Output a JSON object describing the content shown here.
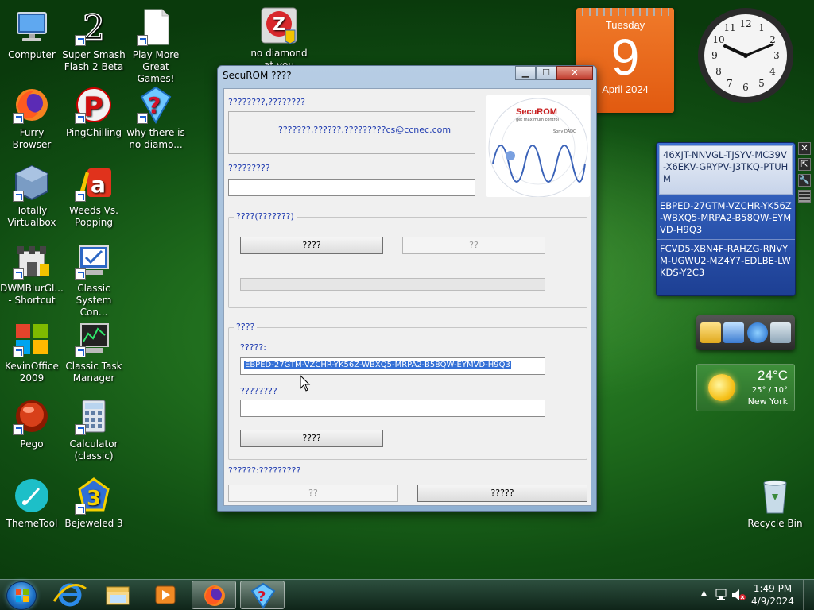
{
  "desktop": {
    "icons": [
      {
        "label": "Computer"
      },
      {
        "label": "Super Smash Flash 2 Beta"
      },
      {
        "label": "Play More Great Games!"
      },
      {
        "label": "no diamond at you"
      },
      {
        "label": "Furry Browser"
      },
      {
        "label": "PingChilling"
      },
      {
        "label": "why there is no diamo..."
      },
      {
        "label": "Totally Virtualbox"
      },
      {
        "label": "Weeds Vs. Popping"
      },
      {
        "label": "DWMBlurGl... - Shortcut"
      },
      {
        "label": "Classic System Con..."
      },
      {
        "label": "KevinOffice 2009"
      },
      {
        "label": "Classic Task Manager"
      },
      {
        "label": "Pego"
      },
      {
        "label": "Calculator (classic)"
      },
      {
        "label": "ThemeTool"
      },
      {
        "label": "Bejeweled 3"
      },
      {
        "label": "Recycle Bin"
      }
    ]
  },
  "calendar": {
    "weekday": "Tuesday",
    "day": "9",
    "month": "April 2024"
  },
  "keys": {
    "items": [
      "46XJT-NNVGL-TJSYV-MC39V-X6EKV-GRYPV-J3TKQ-PTUHM",
      "EBPED-27GTM-VZCHR-YK56Z-WBXQ5-MRPA2-B58QW-EYMVD-H9Q3",
      "FCVD5-XBN4F-RAHZG-RNVYM-UGWU2-MZ4Y7-EDLBE-LWKDS-Y2C3"
    ],
    "selected_index": 0
  },
  "weather": {
    "temp": "24°C",
    "range": "25° / 10°",
    "city": "New York"
  },
  "securom": {
    "title": "SecuROM ????",
    "contact_label": "????????,????????",
    "contact_text": "???????,??????,?????????cs@ccnec.com",
    "field1_label": "?????????",
    "field1_value": "",
    "group1_legend": "????(???????)",
    "group1_btn1": "????",
    "group1_btn2": "??",
    "group2_legend": "????",
    "code_label": "?????:",
    "code_value": "EBPED-27GTM-VZCHR-YK56Z-WBXQ5-MRPA2-B58QW-EYMVD-H9Q3",
    "unlock_label": "????????",
    "unlock_value": "",
    "group2_btn": "????",
    "status_label": "??????:?????????",
    "footer_btn1": "??",
    "footer_btn2": "?????",
    "logo_brand": "SecuROM",
    "logo_tagline": "get maximum control",
    "logo_vendor": "Sony DADC"
  },
  "taskbar": {
    "time": "1:49 PM",
    "date": "4/9/2024"
  }
}
